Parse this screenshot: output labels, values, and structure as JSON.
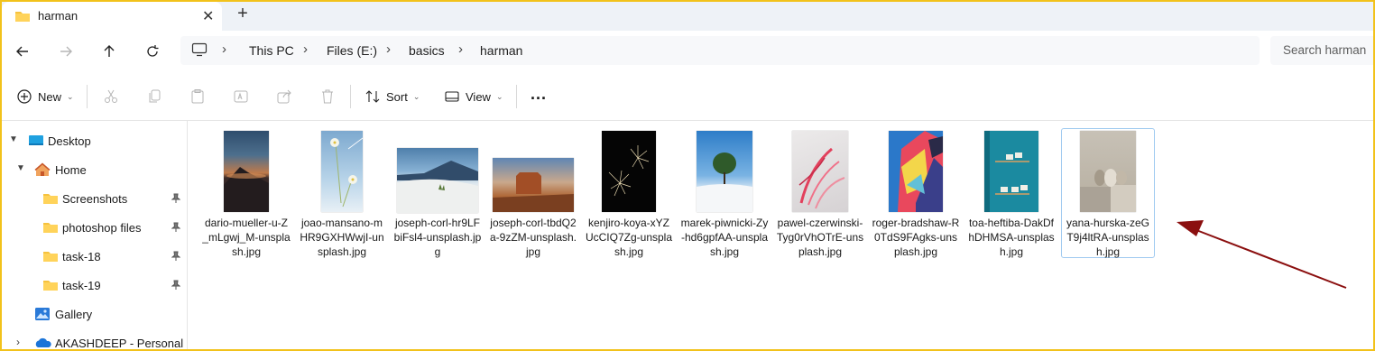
{
  "tab": {
    "title": "harman",
    "close": "✕",
    "new_tab": "+"
  },
  "address": {
    "crumbs": [
      "This PC",
      "Files (E:)",
      "basics",
      "harman"
    ],
    "search_placeholder": "Search harman"
  },
  "toolbar": {
    "new_label": "New",
    "sort_label": "Sort",
    "view_label": "View",
    "more_label": "..."
  },
  "sidebar": {
    "items": [
      {
        "label": "Desktop",
        "icon": "desktop-icon",
        "expanded": true,
        "pinned": false
      },
      {
        "label": "Home",
        "icon": "home-icon",
        "expanded": true,
        "pinned": false
      },
      {
        "label": "Screenshots",
        "icon": "folder-icon",
        "pinned": true
      },
      {
        "label": "photoshop files",
        "icon": "folder-icon",
        "pinned": true
      },
      {
        "label": "task-18",
        "icon": "folder-icon",
        "pinned": true
      },
      {
        "label": "task-19",
        "icon": "folder-icon",
        "pinned": true
      },
      {
        "label": "Gallery",
        "icon": "gallery-icon",
        "pinned": false
      },
      {
        "label": "AKASHDEEP - Personal",
        "icon": "onedrive-icon",
        "expanded": false,
        "pinned": false
      }
    ]
  },
  "files": [
    {
      "name": "dario-mueller-u-Z_mLgwj_M-unsplash.jpg",
      "thumb": "mountain-sunset"
    },
    {
      "name": "joao-mansano-mHR9GXHWwjI-unsplash.jpg",
      "thumb": "white-flowers-sky"
    },
    {
      "name": "joseph-corl-hr9LFbiFsl4-unsplash.jpg",
      "thumb": "white-dunes"
    },
    {
      "name": "joseph-corl-tbdQ2a-9zZM-unsplash.jpg",
      "thumb": "desert-butte"
    },
    {
      "name": "kenjiro-koya-xYZUcCIQ7Zg-unsplash.jpg",
      "thumb": "fireworks"
    },
    {
      "name": "marek-piwnicki-Zy-hd6gpfAA-unsplash.jpg",
      "thumb": "tree-in-snow"
    },
    {
      "name": "pawel-czerwinski-Tyg0rVhOTrE-unsplash.jpg",
      "thumb": "pink-abstract"
    },
    {
      "name": "roger-bradshaw-R0TdS9FAgks-unsplash.jpg",
      "thumb": "colorful-building"
    },
    {
      "name": "toa-heftiba-DakDfhDHMSA-unsplash.jpg",
      "thumb": "teal-wall"
    },
    {
      "name": "yana-hurska-zeGT9j4ltRA-unsplash.jpg",
      "thumb": "ceramic-vases"
    }
  ],
  "selected_file_index": 9,
  "colors": {
    "accent": "#0067c0",
    "frame": "#f2c21b",
    "arrow": "#8b0f0f",
    "selection_border": "#9fcaf0"
  }
}
